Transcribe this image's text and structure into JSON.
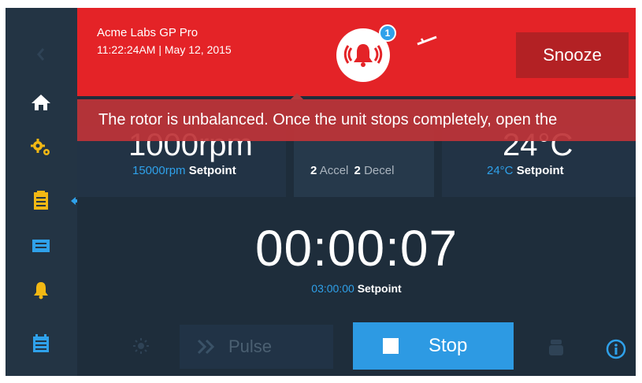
{
  "alert": {
    "app_name": "Acme Labs GP Pro",
    "datetime": "11:22:24AM | May 12, 2015",
    "badge_count": "1",
    "snooze_label": "Snooze",
    "message": "The rotor is unbalanced. Once the unit stops completely, open the"
  },
  "speed": {
    "current": "1000rpm",
    "setpoint_value": "15000rpm",
    "setpoint_label": "Setpoint"
  },
  "accel": {
    "accel_value": "2",
    "accel_label": "Accel",
    "decel_value": "2",
    "decel_label": "Decel"
  },
  "temperature": {
    "current": "24°C",
    "setpoint_value": "24°C",
    "setpoint_label": "Setpoint"
  },
  "timer": {
    "elapsed": "00:00:07",
    "setpoint_value": "03:00:00",
    "setpoint_label": "Setpoint"
  },
  "controls": {
    "pulse_label": "Pulse",
    "stop_label": "Stop"
  },
  "sidebar": {
    "items": [
      "back",
      "home",
      "settings",
      "programs",
      "run-log",
      "alarms",
      "calendar"
    ]
  },
  "colors": {
    "alert_red": "#e42327",
    "accent_blue": "#2fa1ea",
    "background": "#1e2d3b"
  }
}
